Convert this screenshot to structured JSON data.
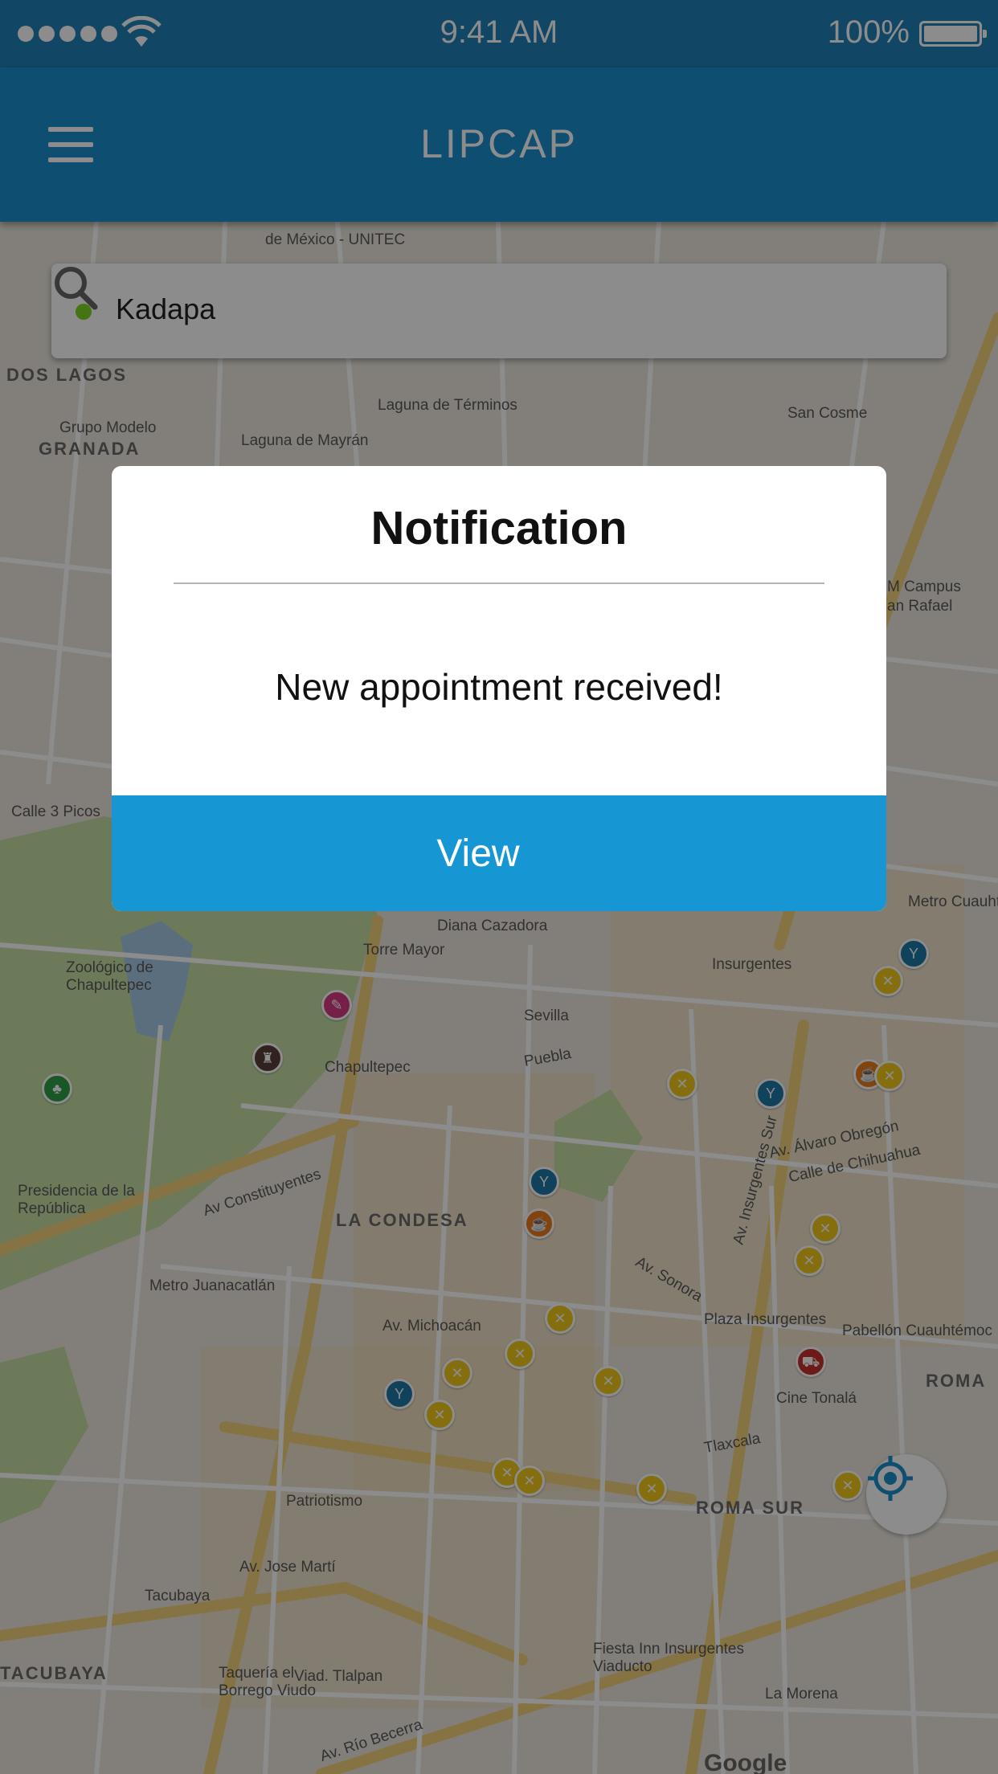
{
  "status_bar": {
    "time": "9:41 AM",
    "battery": "100%"
  },
  "app_bar": {
    "title": "LIPCAP"
  },
  "search": {
    "value": "Kadapa"
  },
  "map": {
    "labels": {
      "dos_lagos": "DOS LAGOS",
      "grupo_modelo": "Grupo Modelo",
      "granada": "GRANADA",
      "laguna_terminos": "Laguna de Términos",
      "laguna_mayran": "Laguna de Mayrán",
      "unitec": "de México - UNITEC",
      "san_cosme": "San Cosme",
      "campus": "M Campus",
      "san_rafael": "an Rafael",
      "calle_picos": "Calle 3 Picos",
      "diana": "Diana Cazadora",
      "torre_mayor": "Torre Mayor",
      "zoologico": "Zoológico de Chapultepec",
      "chapultepec": "Chapultepec",
      "sevilla": "Sevilla",
      "insurgentes": "Insurgentes",
      "presidencia": "Presidencia de la República",
      "av_constituyentes": "Av Constituyentes",
      "la_condesa": "LA CONDESA",
      "metro_juanacatlan": "Metro Juanacatlán",
      "av_michoacan": "Av. Michoacán",
      "plaza_insurgentes": "Plaza Insurgentes",
      "pabellon": "Pabellón Cuauhtémoc",
      "cine_tonala": "Cine Tonalá",
      "roma": "ROMA",
      "roma_sur": "ROMA SUR",
      "patriotismo": "Patriotismo",
      "av_jose_marti": "Av. Jose Martí",
      "tacubaya": "TACUBAYA",
      "metro_tacubaya": "Tacubaya",
      "taqueria": "Taquería el Borrego Viudo",
      "viad_tlalpan": "Viad. Tlalpan",
      "fiesta_inn": "Fiesta Inn Insurgentes Viaducto",
      "la_morena": "La Morena",
      "av_rio_becerra": "Av. Río Becerra",
      "av_alvaro": "Av. Álvaro Obregón",
      "calle_chihuahua": "Calle de Chihuahua",
      "av_sonora": "Av. Sonora",
      "puebla": "Puebla",
      "tlaxcala": "Tlaxcala",
      "metro_cuauhtemoc": "Metro Cuauhtém",
      "av_insurgentes_sur": "Av. Insurgentes Sur"
    },
    "google": "Google"
  },
  "modal": {
    "title": "Notification",
    "message": "New appointment received!",
    "button": "View"
  },
  "colors": {
    "app_bar": "#1b8fcc",
    "button": "#1696d2",
    "search_dot": "#7ed321"
  }
}
